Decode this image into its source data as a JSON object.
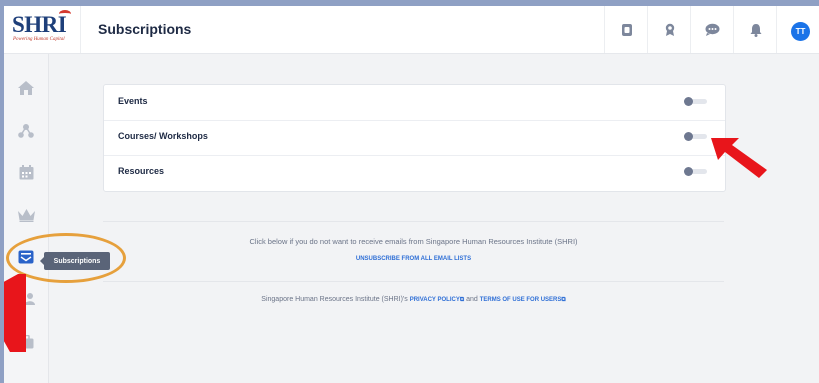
{
  "header": {
    "logo": {
      "main": "SHRI",
      "tagline": "Powering Human Capital"
    },
    "title": "Subscriptions",
    "icons": [
      "ticket-icon",
      "badge-icon",
      "chat-icon",
      "bell-icon"
    ],
    "avatar_initials": "TT"
  },
  "sidebar": {
    "items": [
      "home-icon",
      "network-icon",
      "calendar-icon",
      "crown-icon",
      "subscriptions-icon",
      "people-icon",
      "briefcase-icon"
    ],
    "tooltip": "Subscriptions"
  },
  "subscriptions": [
    {
      "label": "Events",
      "enabled": false
    },
    {
      "label": "Courses/ Workshops",
      "enabled": false
    },
    {
      "label": "Resources",
      "enabled": false
    }
  ],
  "notice": "Click below if you do not want to receive emails from Singapore Human Resources Institute (SHRI)",
  "unsubscribe_link": "UNSUBSCRIBE FROM ALL EMAIL LISTS",
  "footer": {
    "prefix": "Singapore Human Resources Institute (SHRI)'s",
    "privacy_link": "PRIVACY POLICY",
    "connector": "and",
    "terms_link": "TERMS OF USE FOR USERS"
  },
  "colors": {
    "accent": "#1a73e8",
    "annotation_red": "#e8151b",
    "highlight_ring": "#e6a03c"
  }
}
